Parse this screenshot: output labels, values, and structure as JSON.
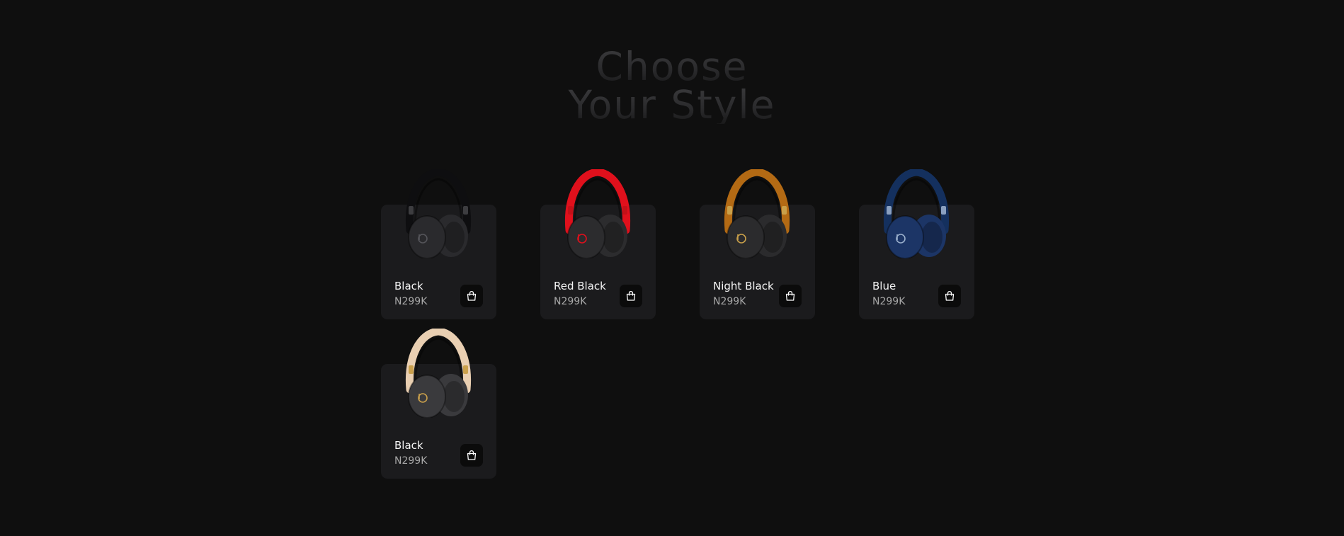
{
  "hero": {
    "line1": "Choose",
    "line2": "Your Style"
  },
  "products": [
    {
      "name": "Black",
      "price": "N299K",
      "band_color": "#0e0e10",
      "cup_color": "#2a2a2d",
      "accent_color": "#3d3d40",
      "logo_color": "#55555a"
    },
    {
      "name": "Red Black",
      "price": "N299K",
      "band_color": "#e0101c",
      "cup_color": "#2c2c2e",
      "accent_color": "#c41018",
      "logo_color": "#e0101c"
    },
    {
      "name": "Night Black",
      "price": "N299K",
      "band_color": "#b36a14",
      "cup_color": "#2b2b2d",
      "accent_color": "#c9a04a",
      "logo_color": "#c9a04a"
    },
    {
      "name": "Blue",
      "price": "N299K",
      "band_color": "#14305e",
      "cup_color": "#1c3566",
      "accent_color": "#8aa0c0",
      "logo_color": "#9bb0cc"
    },
    {
      "name": "Black",
      "price": "N299K",
      "band_color": "#e9cfb2",
      "cup_color": "#3a3a3d",
      "accent_color": "#caa04c",
      "logo_color": "#caa04c"
    }
  ],
  "icons": {
    "cart": "shopping-bag-icon",
    "product": "headphones-icon"
  }
}
